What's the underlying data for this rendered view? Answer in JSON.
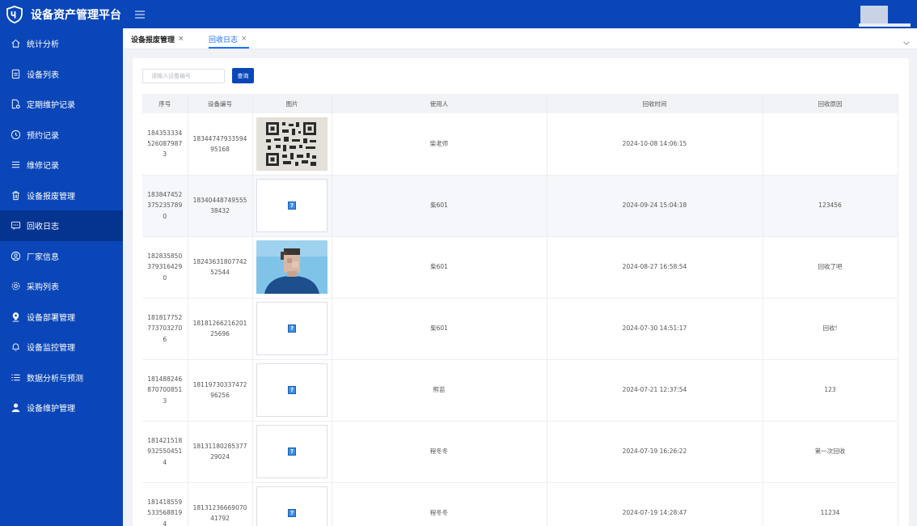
{
  "app": {
    "title": "设备资产管理平台"
  },
  "sidebar": {
    "items": [
      {
        "label": "统计分析",
        "icon": "home-icon"
      },
      {
        "label": "设备列表",
        "icon": "document-icon"
      },
      {
        "label": "定期维护记录",
        "icon": "file-gear-icon"
      },
      {
        "label": "预约记录",
        "icon": "clock-icon"
      },
      {
        "label": "维修记录",
        "icon": "list-icon"
      },
      {
        "label": "设备报废管理",
        "icon": "trash-icon"
      },
      {
        "label": "回收日志",
        "icon": "message-icon",
        "active": true
      },
      {
        "label": "厂家信息",
        "icon": "user-circle-icon"
      },
      {
        "label": "采购列表",
        "icon": "settings-icon"
      },
      {
        "label": "设备部署管理",
        "icon": "location-pin-icon"
      },
      {
        "label": "设备监控管理",
        "icon": "bell-icon"
      },
      {
        "label": "数据分析与预测",
        "icon": "bullet-list-icon"
      },
      {
        "label": "设备维护管理",
        "icon": "user-icon"
      }
    ]
  },
  "tabs": [
    {
      "label": "设备报废管理",
      "close": "×"
    },
    {
      "label": "回收日志",
      "close": "×",
      "active": true
    }
  ],
  "search": {
    "placeholder": "请输入设备编号",
    "value": "",
    "button_label": "查询"
  },
  "table": {
    "headers": [
      "序号",
      "设备编号",
      "图片",
      "使用人",
      "回收时间",
      "回收原因"
    ],
    "rows": [
      {
        "id": "1843533345260879873",
        "device_no": "1834474793359495168",
        "image": "qr-code",
        "user": "柴老师",
        "time": "2024-10-08 14:06:15",
        "reason": ""
      },
      {
        "id": "1838474523752357890",
        "device_no": "1834044874955538432",
        "image": "broken",
        "user": "柴601",
        "time": "2024-09-24 15:04:18",
        "reason": "123456"
      },
      {
        "id": "1828358503793164290",
        "device_no": "1824363180774252544",
        "image": "person-photo",
        "user": "柴601",
        "time": "2024-08-27 16:58:54",
        "reason": "回收了吧"
      },
      {
        "id": "1818177527737032706",
        "device_no": "1818126621620125696",
        "image": "broken",
        "user": "柴601",
        "time": "2024-07-30 14:51:17",
        "reason": "回收!"
      },
      {
        "id": "1814882468707008513",
        "device_no": "1811973033747296256",
        "image": "broken",
        "user": "熊苗",
        "time": "2024-07-21 12:37:54",
        "reason": "123"
      },
      {
        "id": "1814215189325504514",
        "device_no": "1813118028537729024",
        "image": "broken",
        "user": "程冬冬",
        "time": "2024-07-19 16:26:22",
        "reason": "第一次回收"
      },
      {
        "id": "1814185595335688194",
        "device_no": "1813123666907041792",
        "image": "broken",
        "user": "程冬冬",
        "time": "2024-07-19 14:28:47",
        "reason": "11234"
      }
    ]
  },
  "colors": {
    "primary": "#0a46b8",
    "active_menu": "#053490",
    "tab_active": "#1e6ff5"
  }
}
